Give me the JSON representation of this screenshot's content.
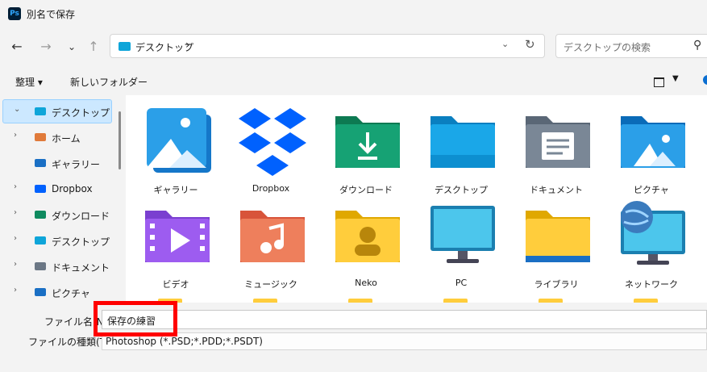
{
  "window": {
    "title": "別名で保存",
    "app_icon_label": "Ps"
  },
  "address": {
    "crumb": "デスクトップ",
    "chevron": "›"
  },
  "search": {
    "placeholder": "デスクトップの検索"
  },
  "commands": {
    "organize": "整理 ▾",
    "new_folder": "新しいフォルダー"
  },
  "nav": {
    "items": [
      {
        "label": "デスクトップ",
        "arrow": "⌄",
        "icon": "desktop-icon",
        "color": "#0ea5d9"
      },
      {
        "label": "ホーム",
        "arrow": "›",
        "icon": "home-icon",
        "color": "#e07a3a"
      },
      {
        "label": "ギャラリー",
        "arrow": "",
        "icon": "gallery-icon",
        "color": "#1a6fc4"
      },
      {
        "label": "Dropbox",
        "arrow": "›",
        "icon": "dropbox-icon",
        "color": "#0061fe"
      },
      {
        "label": "ダウンロード",
        "arrow": "›",
        "icon": "download-icon",
        "color": "#0f8a5f"
      },
      {
        "label": "デスクトップ",
        "arrow": "›",
        "icon": "desktop-icon",
        "color": "#0ea5d9"
      },
      {
        "label": "ドキュメント",
        "arrow": "›",
        "icon": "document-icon",
        "color": "#6b7785"
      },
      {
        "label": "ピクチャ",
        "arrow": "›",
        "icon": "pictures-icon",
        "color": "#1a6fc4"
      }
    ]
  },
  "files": [
    {
      "label": "ギャラリー",
      "icon": "gallery-icon"
    },
    {
      "label": "Dropbox",
      "icon": "dropbox-icon"
    },
    {
      "label": "ダウンロード",
      "icon": "downloads-folder-icon"
    },
    {
      "label": "デスクトップ",
      "icon": "desktop-folder-icon"
    },
    {
      "label": "ドキュメント",
      "icon": "documents-folder-icon"
    },
    {
      "label": "ピクチャ",
      "icon": "pictures-folder-icon"
    },
    {
      "label": "ビデオ",
      "icon": "videos-folder-icon"
    },
    {
      "label": "ミュージック",
      "icon": "music-folder-icon"
    },
    {
      "label": "Neko",
      "icon": "user-folder-icon"
    },
    {
      "label": "PC",
      "icon": "pc-icon"
    },
    {
      "label": "ライブラリ",
      "icon": "library-folder-icon"
    },
    {
      "label": "ネットワーク",
      "icon": "network-icon"
    }
  ],
  "form": {
    "filename_label": "ファイル名(N):",
    "filename_value": "保存の練習",
    "filetype_label": "ファイルの種類(T):",
    "filetype_value": "Photoshop (*.PSD;*.PDD;*.PSDT)"
  },
  "colors": {
    "accent": "#0ea5d9",
    "selection": "#cce8ff",
    "highlight": "#ff0000"
  }
}
